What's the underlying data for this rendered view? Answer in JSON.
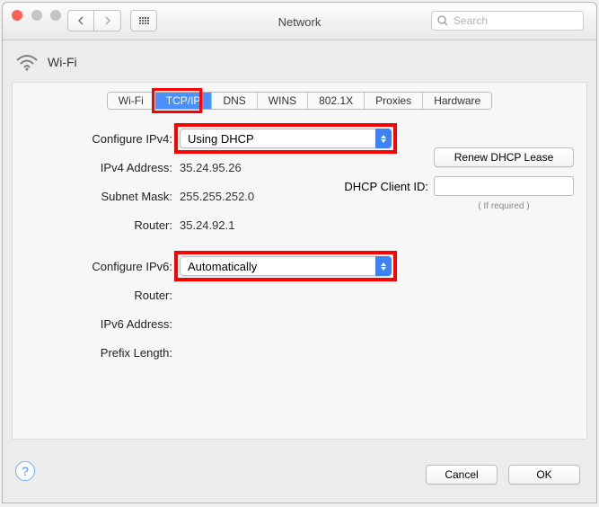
{
  "window": {
    "title": "Network"
  },
  "search": {
    "placeholder": "Search"
  },
  "interface": {
    "name": "Wi-Fi"
  },
  "tabs": {
    "items": [
      "Wi-Fi",
      "TCP/IP",
      "DNS",
      "WINS",
      "802.1X",
      "Proxies",
      "Hardware"
    ],
    "active": "TCP/IP"
  },
  "labels": {
    "config_v4": "Configure IPv4:",
    "ipv4_addr": "IPv4 Address:",
    "subnet": "Subnet Mask:",
    "router": "Router:",
    "config_v6": "Configure IPv6:",
    "router6": "Router:",
    "ipv6_addr": "IPv6 Address:",
    "prefix": "Prefix Length:",
    "dhcp_client": "DHCP Client ID:",
    "if_required": "( If required )"
  },
  "values": {
    "config_v4": "Using DHCP",
    "ipv4_addr": "35.24.95.26",
    "subnet": "255.255.252.0",
    "router": "35.24.92.1",
    "config_v6": "Automatically",
    "router6": "",
    "ipv6_addr": "",
    "prefix": "",
    "dhcp_client": ""
  },
  "buttons": {
    "renew": "Renew DHCP Lease",
    "cancel": "Cancel",
    "ok": "OK"
  }
}
